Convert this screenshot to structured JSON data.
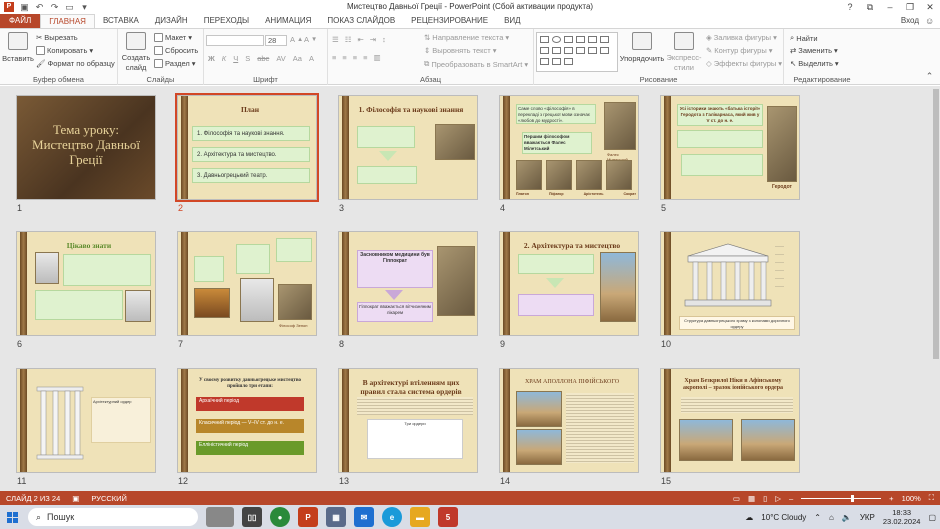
{
  "window": {
    "title": "Мистецтво Давньої Греції - PowerPoint (Сбой активации продукта)",
    "controls": [
      "?",
      "⧉",
      "–",
      "❐",
      "✕"
    ]
  },
  "qat": {
    "app_icon": "P"
  },
  "ribbon_tabs": [
    {
      "label": "ФАЙЛ"
    },
    {
      "label": "ГЛАВНАЯ"
    },
    {
      "label": "ВСТАВКА"
    },
    {
      "label": "ДИЗАЙН"
    },
    {
      "label": "ПЕРЕХОДЫ"
    },
    {
      "label": "АНИМАЦИЯ"
    },
    {
      "label": "ПОКАЗ СЛАЙДОВ"
    },
    {
      "label": "РЕЦЕНЗИРОВАНИЕ"
    },
    {
      "label": "ВИД"
    }
  ],
  "signin": "Вход",
  "ribbon": {
    "clipboard": {
      "paste": "Вставить",
      "cut": "Вырезать",
      "copy": "Копировать",
      "format_painter": "Формат по образцу",
      "label": "Буфер обмена"
    },
    "slides": {
      "new_slide_1": "Создать",
      "new_slide_2": "слайд",
      "layout": "Макет",
      "reset": "Сбросить",
      "section": "Раздел",
      "label": "Слайды"
    },
    "font": {
      "size": "28",
      "label": "Шрифт",
      "bold": "Ж",
      "italic": "К",
      "underline": "Ч",
      "shadow": "S",
      "strike": "abc",
      "spacing": "AV",
      "case": "Aa",
      "color": "A"
    },
    "paragraph": {
      "text_direction": "Направление текста",
      "align_text": "Выровнять текст",
      "smartart": "Преобразовать в SmartArt",
      "label": "Абзац"
    },
    "drawing": {
      "arrange": "Упорядочить",
      "quick_styles_1": "Экспресс-",
      "quick_styles_2": "стили",
      "fill": "Заливка фигуры",
      "outline": "Контур фигуры",
      "effects": "Эффекты фигуры",
      "label": "Рисование"
    },
    "editing": {
      "find": "Найти",
      "replace": "Заменить",
      "select": "Выделить",
      "label": "Редактирование"
    }
  },
  "slides": [
    {
      "num": "1",
      "title_line1": "Тема уроку:",
      "title_line2": "Мистецтво Давньої Греції"
    },
    {
      "num": "2",
      "title": "План",
      "items": [
        "1. Філософія та наукові знання.",
        "2. Архітектура та мистецтво.",
        "3. Давньогрецький театр."
      ]
    },
    {
      "num": "3",
      "title": "1. Філософія та наукові знання"
    },
    {
      "num": "4",
      "title": "Саме слово «філософія» в перекладі з грецької мови означає «любов до мудрості».",
      "caption": "Першим філософом вважається Фалес Мілетський",
      "names": [
        "Платон",
        "Піфагор",
        "Арістотель",
        "Сократ"
      ],
      "label": "Фалес Мілетський"
    },
    {
      "num": "5",
      "title": "Усі історики знають «батька історії» Геродота з Галікарнаса, який жив у V ст. до н. е.",
      "label": "Геродот"
    },
    {
      "num": "6",
      "title": "Цікаво знати"
    },
    {
      "num": "7",
      "label": "Філософ Зенон"
    },
    {
      "num": "8",
      "title": "Засновником медицини був Гіппократ",
      "caption": "Гіппократ вважається вітчизняним лікарем"
    },
    {
      "num": "9",
      "title": "2. Архітектура та мистецтво"
    },
    {
      "num": "10",
      "caption": "Структура давньогрецького храму з колонами доричного ордеру"
    },
    {
      "num": "11",
      "caption": "Архітектурний ордер"
    },
    {
      "num": "12",
      "title": "У своєму розвитку давньогрецьке мистецтво пройшло три етапи:",
      "stages": [
        "Архаїчний період",
        "Класичний період — V–IV ст. до н. е.",
        "Елліністичний період"
      ]
    },
    {
      "num": "13",
      "title": "В архітектурі втіленням цих правил стала система ордерів",
      "caption": "Три ордери"
    },
    {
      "num": "14",
      "title": "ХРАМ АПОЛЛОНА ПІФІЙСЬКОГО"
    },
    {
      "num": "15",
      "title": "Храм Безкрилої Ніки в Афінському акрополі – зразок іонійського ордера"
    }
  ],
  "status": {
    "slide_of": "СЛАЙД 2 ИЗ 24",
    "language": "РУССКИЙ",
    "zoom": "100%",
    "zoom_value": 1.0
  },
  "taskbar": {
    "search": "Пошук",
    "weather": "10°C  Cloudy",
    "lang": "УКР",
    "time": "18:33",
    "date": "23.02.2024"
  },
  "colors": {
    "accent": "#b7472a",
    "selection": "#d24726",
    "parchment": "#f4ead0"
  }
}
